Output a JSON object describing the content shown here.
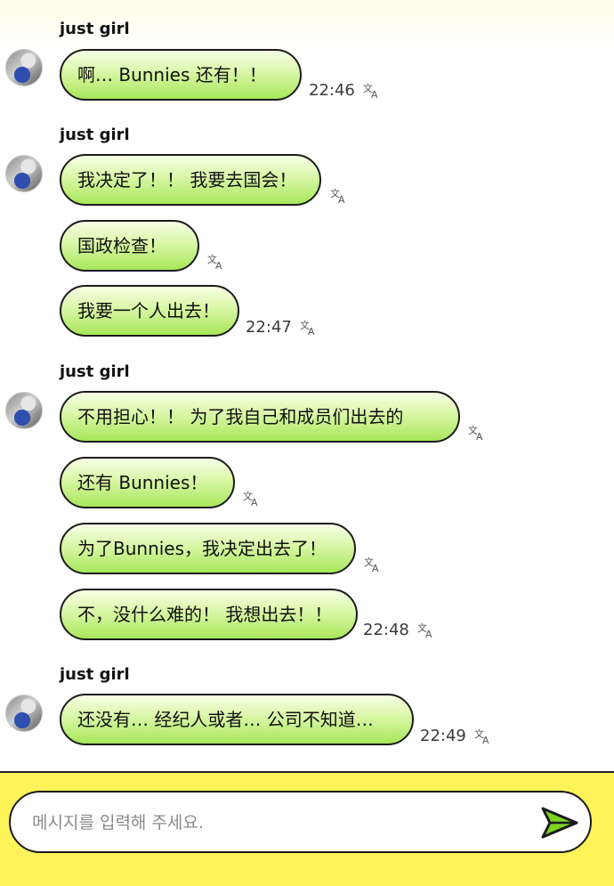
{
  "chat": {
    "groups": [
      {
        "sender": "just girl",
        "messages": [
          {
            "text": "啊… Bunnies 还有！！",
            "time": "22:46"
          }
        ]
      },
      {
        "sender": "just girl",
        "messages": [
          {
            "text": "我决定了！！ 我要去国会！",
            "time": ""
          },
          {
            "text": "国政检查！",
            "time": ""
          },
          {
            "text": "我要一个人出去！",
            "time": "22:47"
          }
        ]
      },
      {
        "sender": "just girl",
        "messages": [
          {
            "text": "不用担心！！ 为了我自己和成员们出去的",
            "time": ""
          },
          {
            "text": "还有 Bunnies！",
            "time": ""
          },
          {
            "text": "为了Bunnies，我决定出去了！",
            "time": ""
          },
          {
            "text": "不，没什么难的！ 我想出去！！",
            "time": "22:48"
          }
        ]
      },
      {
        "sender": "just girl",
        "messages": [
          {
            "text": "还没有… 经纪人或者… 公司不知道…",
            "time": "22:49"
          }
        ]
      }
    ]
  },
  "composer": {
    "placeholder": "메시지를 입력해 주세요."
  },
  "icons": {
    "translate": "translate-icon",
    "send": "send-arrow-icon",
    "avatar": "avatar"
  },
  "colors": {
    "bubble_top": "#f7ffe6",
    "bubble_bottom": "#a8e65a",
    "composer_bg": "#fff35a",
    "send_arrow": "#7ed321"
  }
}
